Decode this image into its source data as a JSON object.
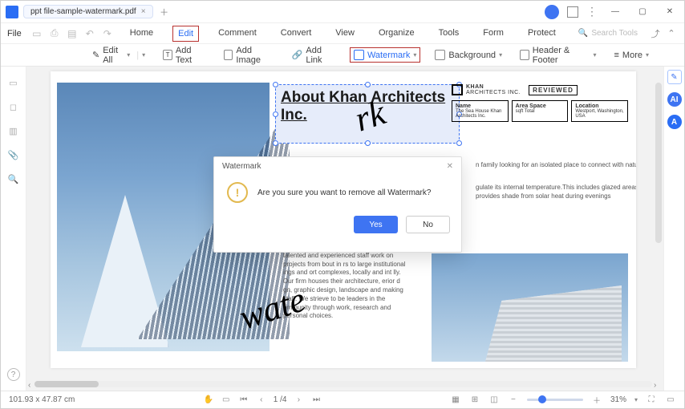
{
  "titlebar": {
    "tab_label": "ppt file-sample-watermark.pdf"
  },
  "menu": {
    "file": "File",
    "items": [
      "Home",
      "Edit",
      "Comment",
      "Convert",
      "View",
      "Organize",
      "Tools",
      "Form",
      "Protect"
    ],
    "active_index": 1,
    "search_placeholder": "Search Tools"
  },
  "toolbar": {
    "edit_all": "Edit All",
    "add_text": "Add Text",
    "add_image": "Add Image",
    "add_link": "Add Link",
    "watermark": "Watermark",
    "background": "Background",
    "header_footer": "Header & Footer",
    "more": "More"
  },
  "document": {
    "heading": "About Khan Architects Inc.",
    "logo_name": "KHAN",
    "logo_sub": "ARCHITECTS INC.",
    "reviewed": "REVIEWED",
    "cells": [
      {
        "title": "Name",
        "value": "The Sea House Khan Architects Inc."
      },
      {
        "title": "Area Space",
        "value": "sqft Total"
      },
      {
        "title": "Location",
        "value": "Westport, Washington, USA"
      }
    ],
    "para1": "n family looking for an isolated place to connect with nature",
    "para2": "gulate its internal temperature.This includes glazed areas  ingroof provides shade from solar heat during evenings",
    "para3": "firm based in Cal       US. Our exceptionally talented and experienced staff work on projects from bout    in    rs to large institutional    ings and    ort complexes, locally and int        lly. Our firm houses their architecture,   erior d   gn, graphic design, landscape and      making staff. We strieve to be leaders in the  ommunity through work, research and personal choices.",
    "watermark_a": "rk",
    "watermark_b": "wate"
  },
  "dialog": {
    "title": "Watermark",
    "message": "Are you sure you want to remove all Watermark?",
    "yes": "Yes",
    "no": "No"
  },
  "status": {
    "coords": "101.93 x 47.87 cm",
    "page_current": "1",
    "page_total": "4",
    "zoom": "31%"
  }
}
